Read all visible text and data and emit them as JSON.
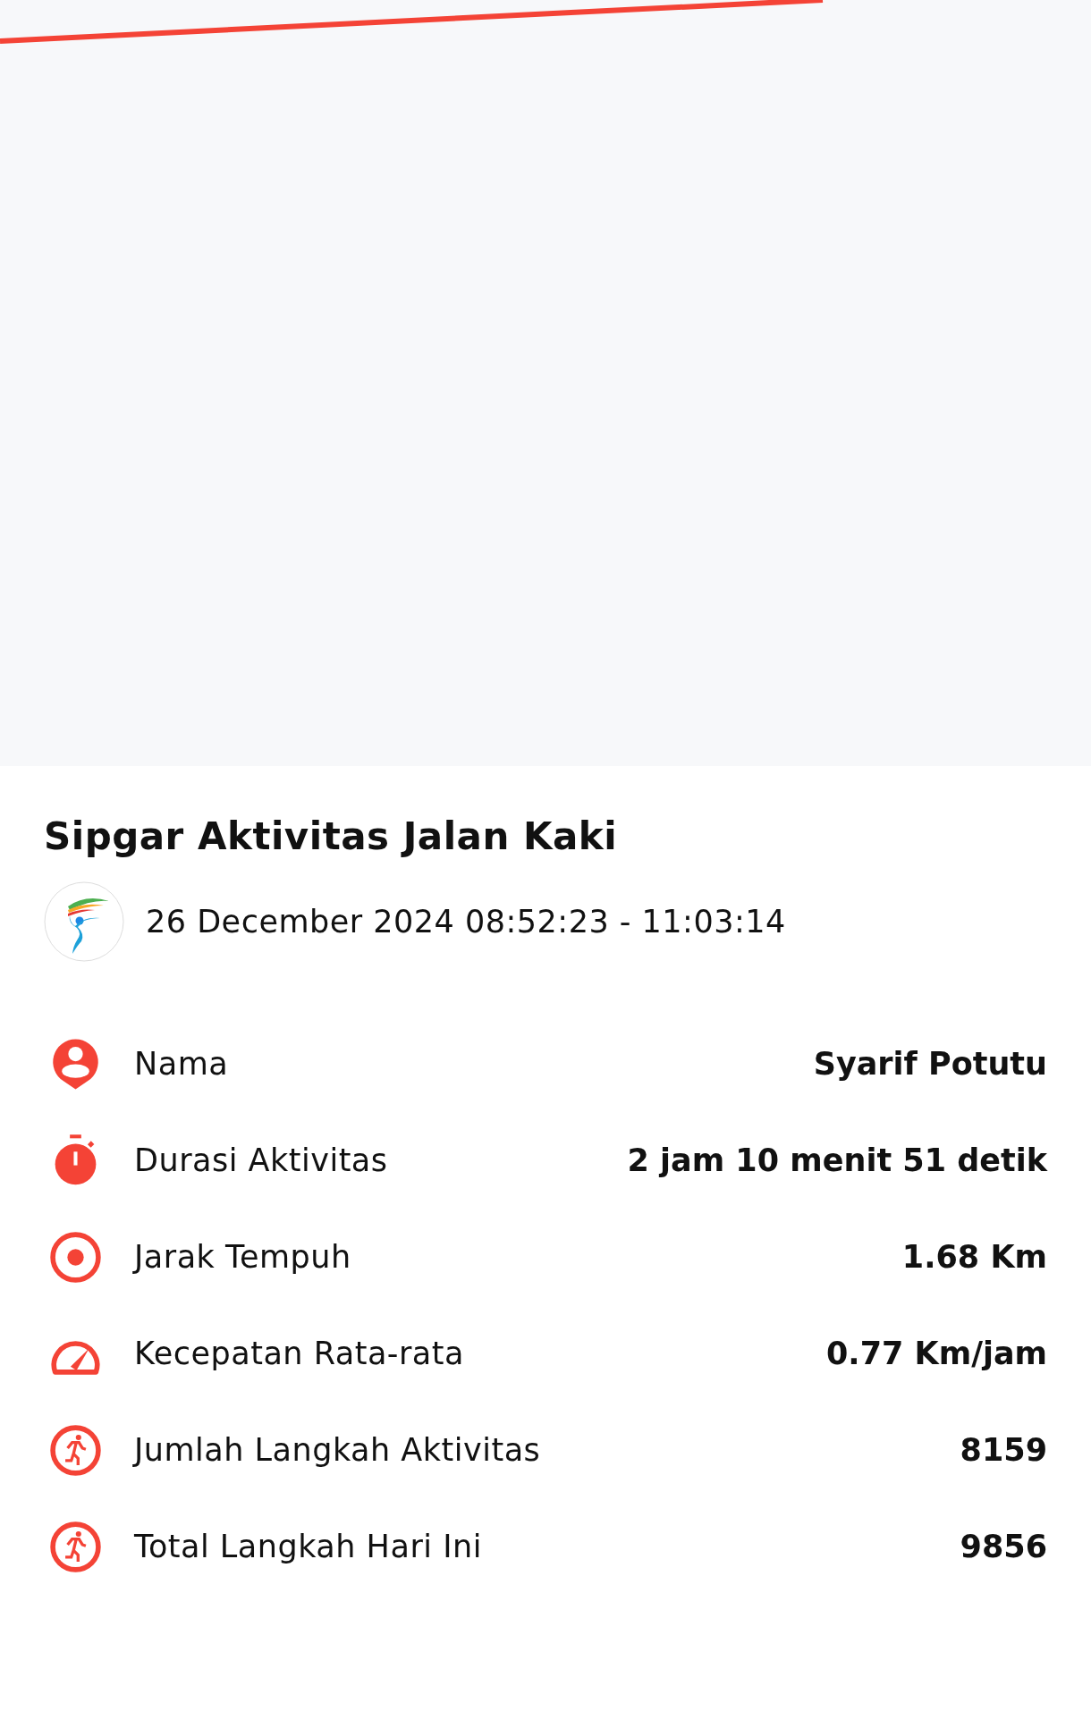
{
  "map": {
    "kind": "route"
  },
  "activity": {
    "title": "Sipgar Aktivitas Jalan Kaki",
    "date": "26 December 2024 08:52:23 - 11:03:14"
  },
  "stats": [
    {
      "kind": "person",
      "label": "Nama",
      "value": "Syarif Potutu"
    },
    {
      "kind": "stopwatch",
      "label": "Durasi Aktivitas",
      "value": "2 jam 10 menit 51 detik"
    },
    {
      "kind": "target",
      "label": "Jarak Tempuh",
      "value": "1.68 Km"
    },
    {
      "kind": "speedometer",
      "label": "Kecepatan Rata-rata",
      "value": "0.77 Km/jam"
    },
    {
      "kind": "runner",
      "label": "Jumlah Langkah Aktivitas",
      "value": "8159"
    },
    {
      "kind": "runner",
      "label": "Total Langkah Hari Ini",
      "value": "9856"
    }
  ]
}
